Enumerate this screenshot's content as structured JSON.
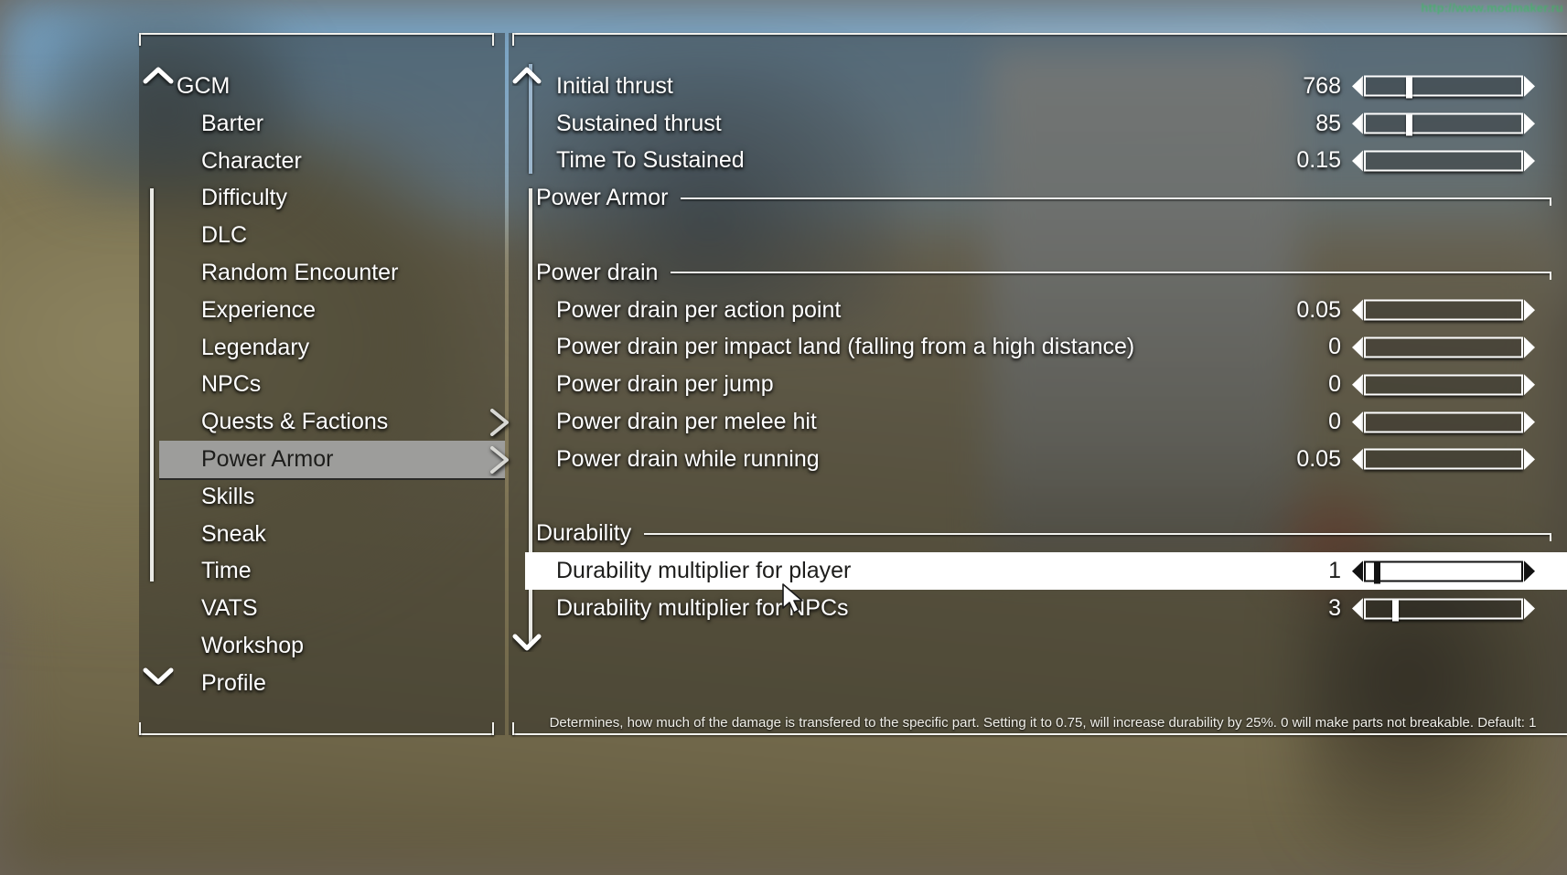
{
  "watermark": "http://www.modmaker.ru",
  "sidebar": {
    "items": [
      {
        "label": "GCM",
        "root": true,
        "selected": false,
        "submenu": false
      },
      {
        "label": "Barter",
        "root": false,
        "selected": false,
        "submenu": false
      },
      {
        "label": "Character",
        "root": false,
        "selected": false,
        "submenu": false
      },
      {
        "label": "Difficulty",
        "root": false,
        "selected": false,
        "submenu": false
      },
      {
        "label": "DLC",
        "root": false,
        "selected": false,
        "submenu": false
      },
      {
        "label": "Random Encounter",
        "root": false,
        "selected": false,
        "submenu": false
      },
      {
        "label": "Experience",
        "root": false,
        "selected": false,
        "submenu": false
      },
      {
        "label": "Legendary",
        "root": false,
        "selected": false,
        "submenu": false
      },
      {
        "label": "NPCs",
        "root": false,
        "selected": false,
        "submenu": false
      },
      {
        "label": "Quests & Factions",
        "root": false,
        "selected": false,
        "submenu": true
      },
      {
        "label": "Power Armor",
        "root": false,
        "selected": true,
        "submenu": true
      },
      {
        "label": "Skills",
        "root": false,
        "selected": false,
        "submenu": false
      },
      {
        "label": "Sneak",
        "root": false,
        "selected": false,
        "submenu": false
      },
      {
        "label": "Time",
        "root": false,
        "selected": false,
        "submenu": false
      },
      {
        "label": "VATS",
        "root": false,
        "selected": false,
        "submenu": false
      },
      {
        "label": "Workshop",
        "root": false,
        "selected": false,
        "submenu": false
      },
      {
        "label": "Profile",
        "root": false,
        "selected": false,
        "submenu": false
      }
    ],
    "scroll_up_icon": "chevron-up-icon",
    "scroll_down_icon": "chevron-down-icon"
  },
  "main": {
    "scroll_up_icon": "chevron-up-icon",
    "scroll_down_icon": "chevron-down-icon",
    "rows": [
      {
        "kind": "setting",
        "label": "Initial thrust",
        "value": "768",
        "selected": false,
        "fill_pct": 26,
        "thumb": true
      },
      {
        "kind": "setting",
        "label": "Sustained thrust",
        "value": "85",
        "selected": false,
        "fill_pct": 26,
        "thumb": true
      },
      {
        "kind": "setting",
        "label": "Time To Sustained",
        "value": "0.15",
        "selected": false,
        "fill_pct": 3,
        "thumb": false
      },
      {
        "kind": "section",
        "label": "Power Armor",
        "level": 0
      },
      {
        "kind": "spacer"
      },
      {
        "kind": "section",
        "label": "Power drain",
        "level": 1
      },
      {
        "kind": "setting",
        "label": "Power drain per action point",
        "value": "0.05",
        "selected": false,
        "fill_pct": 2,
        "thumb": false
      },
      {
        "kind": "setting",
        "label": "Power drain per impact land (falling from a high distance)",
        "value": "0",
        "selected": false,
        "fill_pct": 0,
        "thumb": false
      },
      {
        "kind": "setting",
        "label": "Power drain per jump",
        "value": "0",
        "selected": false,
        "fill_pct": 0,
        "thumb": false
      },
      {
        "kind": "setting",
        "label": "Power drain per melee hit",
        "value": "0",
        "selected": false,
        "fill_pct": 0,
        "thumb": false
      },
      {
        "kind": "setting",
        "label": "Power drain while running",
        "value": "0.05",
        "selected": false,
        "fill_pct": 2,
        "thumb": false
      },
      {
        "kind": "spacer"
      },
      {
        "kind": "section",
        "label": "Durability",
        "level": 1
      },
      {
        "kind": "setting",
        "label": "Durability multiplier for player",
        "value": "1",
        "selected": true,
        "fill_pct": 5,
        "thumb": true
      },
      {
        "kind": "setting",
        "label": "Durability multiplier for NPCs",
        "value": "3",
        "selected": false,
        "fill_pct": 17,
        "thumb": true
      }
    ],
    "description": "Determines, how much of the damage is transfered to the specific part. Setting it to 0.75, will increase durability by 25%. 0 will make parts not breakable. Default: 1"
  },
  "colors": {
    "highlight_row": "#ffffff",
    "highlight_nav": "#9d9d9b",
    "frame": "#f2f2ee",
    "text": "#ffffff",
    "watermark": "#32c15a"
  },
  "cursor": {
    "icon": "mouse-pointer-icon"
  }
}
